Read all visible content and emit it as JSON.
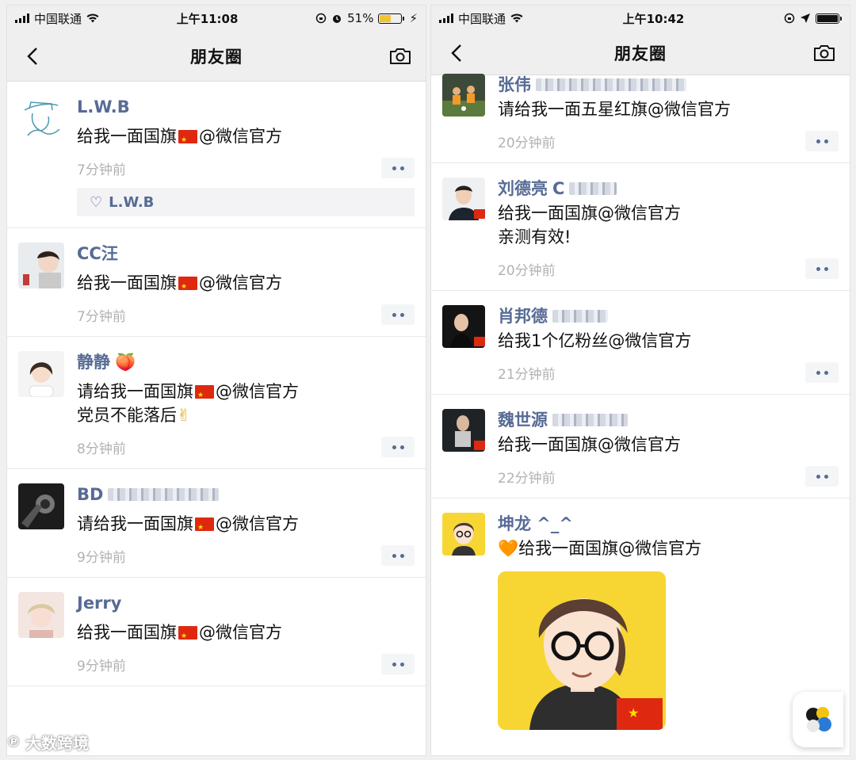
{
  "left": {
    "status": {
      "carrier": "中国联通",
      "time": "上午11:08",
      "battery": "51%",
      "battery_color": "#f4c430"
    },
    "title": "朋友圈",
    "posts": [
      {
        "name": "L.W.B",
        "text_before": "给我一面国旗",
        "text_after": "@微信官方",
        "time": "7分钟前",
        "likes": "L.W.B"
      },
      {
        "name": "CC汪",
        "text_before": "给我一面国旗",
        "text_after": "@微信官方",
        "time": "7分钟前"
      },
      {
        "name": "静静",
        "name_emoji": "🍑",
        "text_before": "请给我一面国旗",
        "text_after": "@微信官方",
        "line2": "党员不能落后",
        "line2_emoji": "✌",
        "time": "8分钟前"
      },
      {
        "name": "BD",
        "text_before": "请给我一面国旗",
        "text_after": "@微信官方",
        "time": "9分钟前"
      },
      {
        "name": "Jerry",
        "text_before": "给我一面国旗",
        "text_after": "@微信官方",
        "time": "9分钟前"
      }
    ]
  },
  "right": {
    "status": {
      "carrier": "中国联通",
      "time": "上午10:42"
    },
    "title": "朋友圈",
    "posts": [
      {
        "name": "张伟",
        "text": "请给我一面五星红旗@微信官方",
        "time": "20分钟前"
      },
      {
        "name": "刘德亮",
        "name_suffix": "C",
        "text": "给我一面国旗@微信官方",
        "line2": "亲测有效!",
        "time": "20分钟前"
      },
      {
        "name": "肖邦德",
        "text": "给我1个亿粉丝@微信官方",
        "time": "21分钟前"
      },
      {
        "name": "魏世源",
        "text": "给我一面国旗@微信官方",
        "time": "22分钟前"
      },
      {
        "name": "坤龙 ^_^",
        "text_emoji": "🧡",
        "text": "给我一面国旗@微信官方"
      }
    ]
  },
  "watermark": "大数跨境",
  "colors": {
    "name": "#576b95",
    "time": "#b2b2b2",
    "flag": "#de2910",
    "nav_bg": "#efefef"
  }
}
